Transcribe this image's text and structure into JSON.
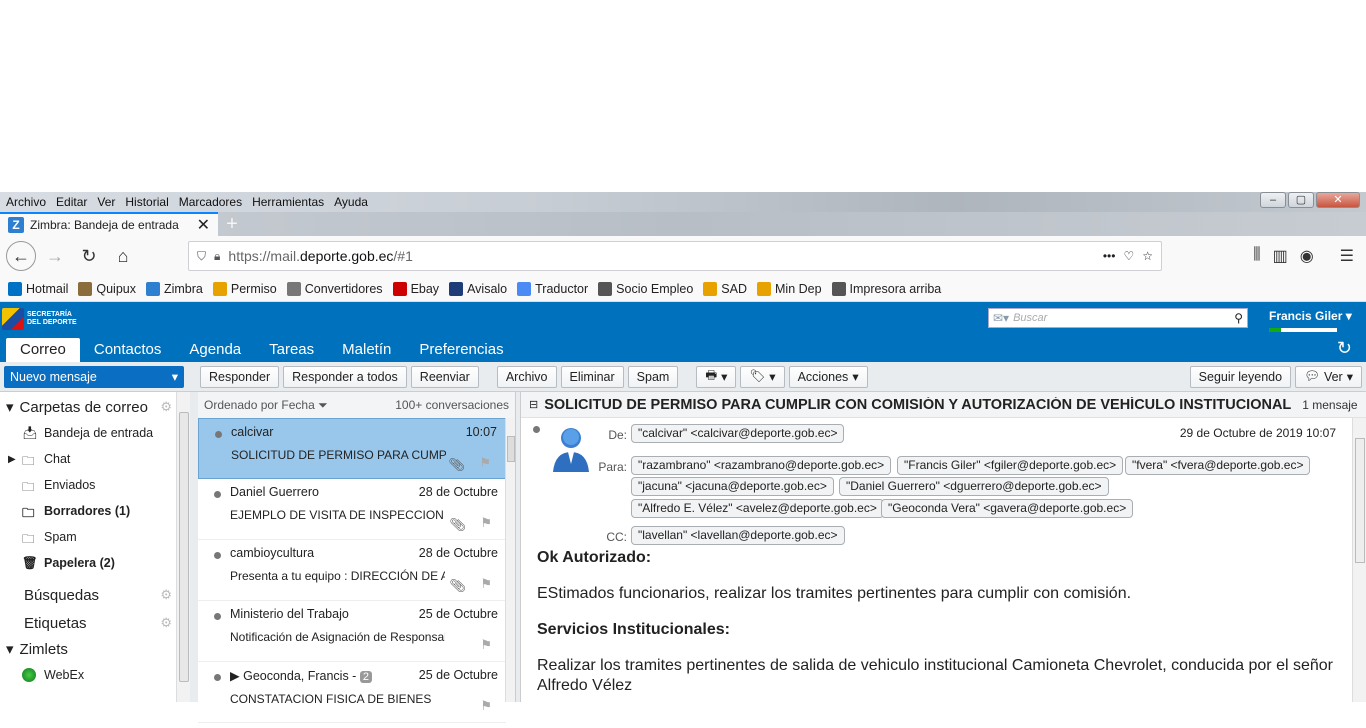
{
  "browser": {
    "menu": [
      "Archivo",
      "Editar",
      "Ver",
      "Historial",
      "Marcadores",
      "Herramientas",
      "Ayuda"
    ],
    "tab_title": "Zimbra: Bandeja de entrada",
    "url_prefix": "https://mail.",
    "url_domain": "deporte.gob.ec",
    "url_suffix": "/#1",
    "bookmarks": [
      {
        "label": "Hotmail",
        "color": "#0072c6"
      },
      {
        "label": "Quipux",
        "color": "#8a6d3b"
      },
      {
        "label": "Zimbra",
        "color": "#2f7fd1"
      },
      {
        "label": "Permiso",
        "color": "#e8a200"
      },
      {
        "label": "Convertidores",
        "color": "#777"
      },
      {
        "label": "Ebay",
        "color": "#c00"
      },
      {
        "label": "Avisalo",
        "color": "#1d3c78"
      },
      {
        "label": "Traductor",
        "color": "#4a8af4"
      },
      {
        "label": "Socio Empleo",
        "color": "#555"
      },
      {
        "label": "SAD",
        "color": "#e8a200"
      },
      {
        "label": "Min Dep",
        "color": "#e8a200"
      },
      {
        "label": "Impresora arriba",
        "color": "#555"
      }
    ]
  },
  "zimbra": {
    "logo_text": "SECRETARÍA DEL DEPORTE",
    "search_placeholder": "Buscar",
    "user": "Francis Giler",
    "app_tabs": [
      "Correo",
      "Contactos",
      "Agenda",
      "Tareas",
      "Maletín",
      "Preferencias"
    ],
    "toolbar": {
      "new_message": "Nuevo mensaje",
      "reply": "Responder",
      "reply_all": "Responder a todos",
      "forward": "Reenviar",
      "archive": "Archivo",
      "delete": "Eliminar",
      "spam": "Spam",
      "actions": "Acciones",
      "keep_reading": "Seguir leyendo",
      "view": "Ver"
    },
    "folders_header": "Carpetas de correo",
    "folders": [
      {
        "label": "Bandeja de entrada",
        "bold": false
      },
      {
        "label": "Chat",
        "bold": false
      },
      {
        "label": "Enviados",
        "bold": false
      },
      {
        "label": "Borradores (1)",
        "bold": true
      },
      {
        "label": "Spam",
        "bold": false
      },
      {
        "label": "Papelera (2)",
        "bold": true
      }
    ],
    "searches_header": "Búsquedas",
    "tags_header": "Etiquetas",
    "zimlets_header": "Zimlets",
    "zimlets": [
      "WebEx"
    ],
    "list_sort": "Ordenado por Fecha",
    "list_count": "100+ conversaciones",
    "messages": [
      {
        "from": "calcivar",
        "date": "10:07",
        "subject": "SOLICITUD DE PERMISO PARA CUMPLIR"
      },
      {
        "from": "Daniel Guerrero",
        "date": "28 de Octubre",
        "subject": "EJEMPLO DE VISITA DE INSPECCION"
      },
      {
        "from": "cambioycultura",
        "date": "28 de Octubre",
        "subject": "Presenta a tu equipo : DIRECCIÓN DE ASE"
      },
      {
        "from": "Ministerio del Trabajo",
        "date": "25 de Octubre",
        "subject": "Notificación de Asignación de Responsabilida"
      },
      {
        "from": "Geoconda, Francis -",
        "date": "25 de Octubre",
        "subject": "CONSTATACION FISICA DE BIENES",
        "count": "2"
      }
    ],
    "reader": {
      "subject": "SOLICITUD DE PERMISO PARA CUMPLIR CON COMISIÓN Y AUTORIZACIÓN DE VEHÍCULO INSTITUCIONAL",
      "count": "1 mensaje",
      "from_label": "De:",
      "to_label": "Para:",
      "cc_label": "CC:",
      "from": "\"calcivar\" <calcivar@deporte.gob.ec>",
      "date": "29 de Octubre de 2019 10:07",
      "to": [
        "\"razambrano\" <razambrano@deporte.gob.ec>",
        "\"Francis Giler\" <fgiler@deporte.gob.ec>",
        "\"fvera\" <fvera@deporte.gob.ec>",
        "\"jacuna\" <jacuna@deporte.gob.ec>",
        "\"Daniel Guerrero\" <dguerrero@deporte.gob.ec>",
        "\"Alfredo E. Vélez\" <avelez@deporte.gob.ec>",
        "\"Geoconda Vera\" <gavera@deporte.gob.ec>"
      ],
      "cc": [
        "\"lavellan\" <lavellan@deporte.gob.ec>"
      ],
      "body": [
        {
          "text": "Ok Autorizado:",
          "bold": true
        },
        {
          "text": "EStimados funcionarios, realizar los tramites pertinentes para cumplir con comisión.",
          "bold": false
        },
        {
          "text": "Servicios Institucionales:",
          "bold": true
        },
        {
          "text": "Realizar los tramites pertinentes de salida de vehiculo institucional Camioneta Chevrolet, conducida por el señor Alfredo Vélez",
          "bold": false
        }
      ]
    }
  },
  "colors": {
    "accent": "#0071bc",
    "selected_row": "#99c7eb",
    "new_button": "#0a6fc2"
  }
}
